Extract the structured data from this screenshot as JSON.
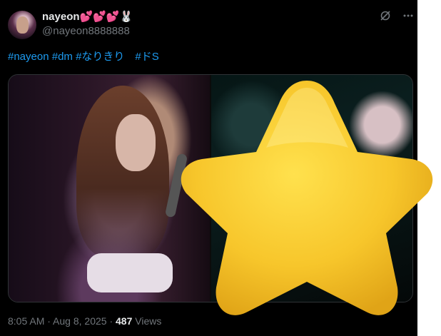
{
  "user": {
    "display_name": "nayeon",
    "name_emojis": "💕💕💕🐰",
    "handle": "@nayeon8888888"
  },
  "header_icons": [
    "grok-icon",
    "more-icon"
  ],
  "tweet": {
    "text": "#nayeon #dm #なりきり　#ドS"
  },
  "meta": {
    "time": "8:05 AM",
    "separator1": " · ",
    "date": "Aug 8, 2025",
    "separator2": " · ",
    "views_count": "487",
    "views_label": " Views"
  },
  "colors": {
    "background": "#000000",
    "text_primary": "#e7e9ea",
    "text_secondary": "#71767b",
    "link": "#1d9bf0",
    "star_fill": "#f5c52a"
  }
}
